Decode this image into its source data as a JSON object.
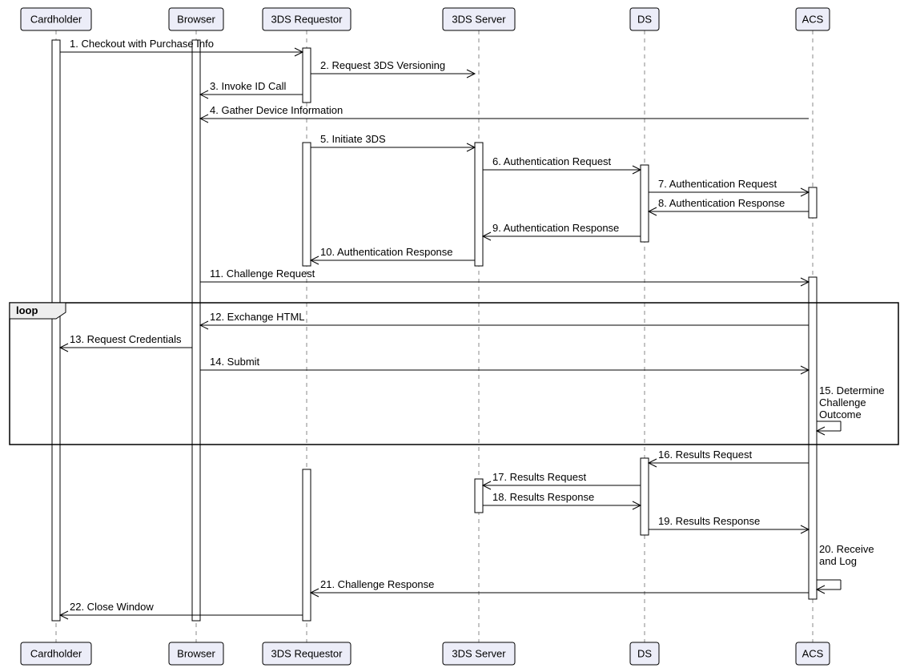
{
  "diagram": {
    "type": "sequence",
    "actors": [
      {
        "id": "cardholder",
        "label": "Cardholder"
      },
      {
        "id": "browser",
        "label": "Browser"
      },
      {
        "id": "requestor",
        "label": "3DS Requestor"
      },
      {
        "id": "server",
        "label": "3DS Server"
      },
      {
        "id": "ds",
        "label": "DS"
      },
      {
        "id": "acs",
        "label": "ACS"
      }
    ],
    "fragments": [
      {
        "type": "loop",
        "label": "loop",
        "start": 12,
        "end": 15
      }
    ],
    "messages": [
      {
        "n": 1,
        "from": "cardholder",
        "to": "requestor",
        "text": "1. Checkout with Purchase Info"
      },
      {
        "n": 2,
        "from": "requestor",
        "to": "server",
        "text": "2. Request 3DS Versioning"
      },
      {
        "n": 3,
        "from": "requestor",
        "to": "browser",
        "text": "3. Invoke ID Call"
      },
      {
        "n": 4,
        "from": "acs",
        "to": "browser",
        "text": "4. Gather Device Information"
      },
      {
        "n": 5,
        "from": "requestor",
        "to": "server",
        "text": "5. Initiate 3DS"
      },
      {
        "n": 6,
        "from": "server",
        "to": "ds",
        "text": "6. Authentication Request"
      },
      {
        "n": 7,
        "from": "ds",
        "to": "acs",
        "text": "7. Authentication Request"
      },
      {
        "n": 8,
        "from": "acs",
        "to": "ds",
        "text": "8. Authentication Response"
      },
      {
        "n": 9,
        "from": "ds",
        "to": "server",
        "text": "9. Authentication Response"
      },
      {
        "n": 10,
        "from": "server",
        "to": "requestor",
        "text": "10. Authentication Response"
      },
      {
        "n": 11,
        "from": "browser",
        "to": "acs",
        "text": "11. Challenge Request"
      },
      {
        "n": 12,
        "from": "acs",
        "to": "browser",
        "text": "12. Exchange HTML"
      },
      {
        "n": 13,
        "from": "browser",
        "to": "cardholder",
        "text": "13. Request Credentials"
      },
      {
        "n": 14,
        "from": "browser",
        "to": "acs",
        "text": "14. Submit"
      },
      {
        "n": 15,
        "from": "acs",
        "to": "acs",
        "text": "15. Determine Challenge Outcome",
        "self": true
      },
      {
        "n": 16,
        "from": "acs",
        "to": "ds",
        "text": "16. Results Request"
      },
      {
        "n": 17,
        "from": "ds",
        "to": "server",
        "text": "17. Results Request"
      },
      {
        "n": 18,
        "from": "server",
        "to": "ds",
        "text": "18. Results Response"
      },
      {
        "n": 19,
        "from": "ds",
        "to": "acs",
        "text": "19. Results Response"
      },
      {
        "n": 20,
        "from": "acs",
        "to": "acs",
        "text": "20. Receive and Log",
        "self": true
      },
      {
        "n": 21,
        "from": "acs",
        "to": "requestor",
        "text": "21. Challenge Response"
      },
      {
        "n": 22,
        "from": "requestor",
        "to": "cardholder",
        "text": "22. Close Window"
      }
    ]
  }
}
